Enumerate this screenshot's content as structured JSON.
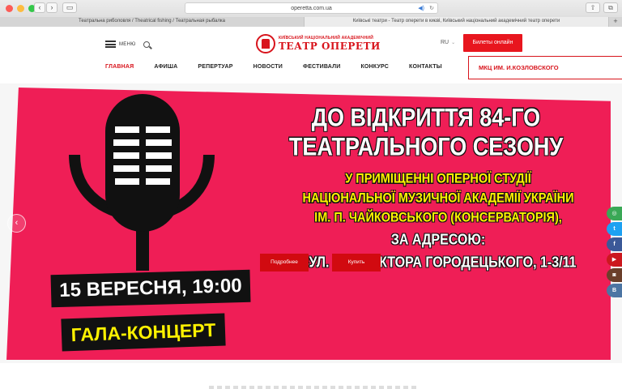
{
  "browser": {
    "url": "operetta.com.ua",
    "tabs": [
      {
        "label": "Театральна риболовля / Theatrical fishing / Театральная рыбалка"
      },
      {
        "label": "Київські театри - Театр оперети в києві, Київський національний академічний театр оперети"
      }
    ],
    "colors": {
      "close": "#fc5c57",
      "minimize": "#fdbc40",
      "maximize": "#34c84a"
    }
  },
  "header": {
    "menu_label": "МЕНЮ",
    "logo_small": "КИЇВСЬКИЙ НАЦІОНАЛЬНИЙ АКАДЕМІЧНИЙ",
    "logo_big": "ТЕАТР ОПЕРЕТИ",
    "lang": "RU",
    "tickets_label": "Билеты онлайн",
    "nav": [
      {
        "label": "ГЛАВНАЯ"
      },
      {
        "label": "АФИША"
      },
      {
        "label": "РЕПЕРТУАР"
      },
      {
        "label": "НОВОСТИ"
      },
      {
        "label": "ФЕСТИВАЛИ"
      },
      {
        "label": "КОНКУРС"
      },
      {
        "label": "КОНТАКТЫ"
      }
    ],
    "mkc_label": "МКЦ ИМ. И.КОЗЛОВСКОГО"
  },
  "hero": {
    "line1": "ДО ВІДКРИТТЯ 84-ГО",
    "line2": "ТЕАТРАЛЬНОГО  СЕЗОНУ",
    "line3": "У ПРИМІЩЕННІ ОПЕРНОЇ СТУДІЇ",
    "line4": "НАЦІОНАЛЬНОЇ МУЗИЧНОЇ АКАДЕМІЇ УКРАЇНИ",
    "line5": "ІМ. П. ЧАЙКОВСЬКОГО (КОНСЕРВАТОРІЯ),",
    "line6": "ЗА АДРЕСОЮ:",
    "line7": "ВУЛ. АРХІТЕКТОРА ГОРОДЕЦЬКОГО, 1-3/11",
    "date": "15 ВЕРЕСНЯ, 19:00",
    "gala": "ГАЛА-КОНЦЕРТ",
    "details_label": "Подробнее",
    "buy_label": "Купить",
    "poster_color": "#ef1e56"
  },
  "social": [
    {
      "icon": "tripadvisor-icon",
      "glyph": "◎",
      "color": "#3aa856"
    },
    {
      "icon": "twitter-icon",
      "glyph": "t",
      "color": "#1da1f2"
    },
    {
      "icon": "facebook-icon",
      "glyph": "f",
      "color": "#3b5998"
    },
    {
      "icon": "youtube-icon",
      "glyph": "▶",
      "color": "#cc181e"
    },
    {
      "icon": "instagram-icon",
      "glyph": "◙",
      "color": "#6b3f2a"
    },
    {
      "icon": "vk-icon",
      "glyph": "В",
      "color": "#4c75a3"
    }
  ]
}
